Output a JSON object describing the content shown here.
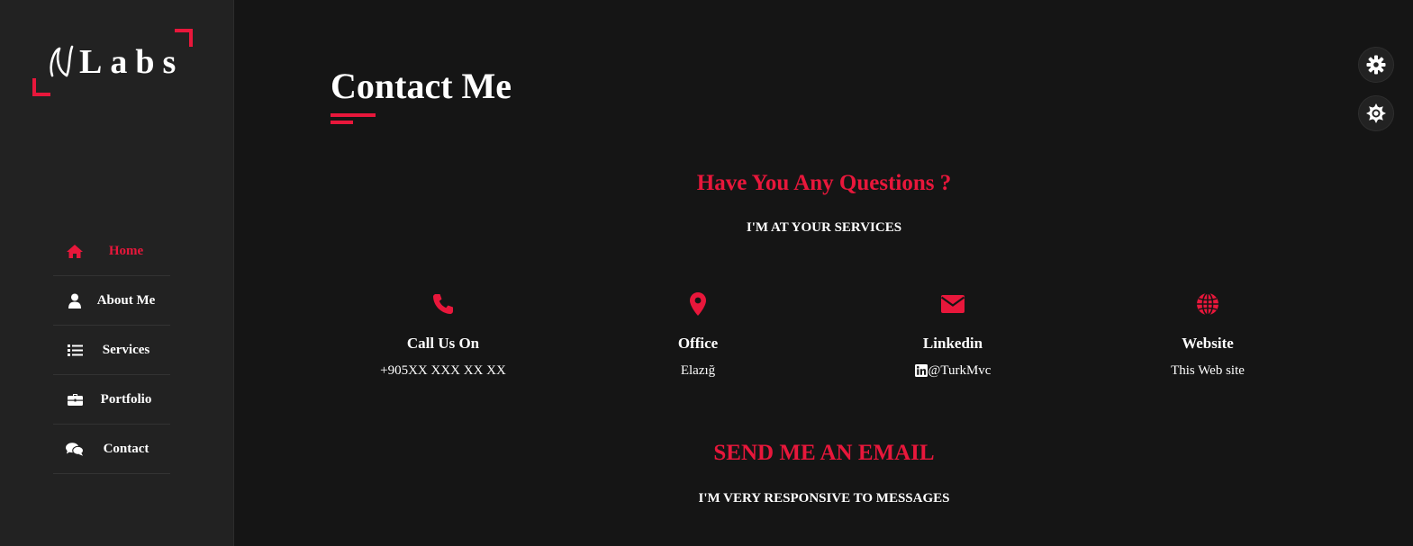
{
  "logo": {
    "text": "Labs"
  },
  "nav": {
    "items": [
      {
        "label": "Home",
        "icon": "home-icon",
        "active": true
      },
      {
        "label": "About Me",
        "icon": "user-icon"
      },
      {
        "label": "Services",
        "icon": "list-icon"
      },
      {
        "label": "Portfolio",
        "icon": "briefcase-icon"
      },
      {
        "label": "Contact",
        "icon": "comments-icon"
      }
    ]
  },
  "main": {
    "title": "Contact Me",
    "questions_heading": "Have You Any Questions ?",
    "questions_sub": "I'M AT YOUR SERVICES",
    "cards": [
      {
        "title": "Call Us On",
        "value": "+905XX XXX XX XX",
        "icon": "phone-icon"
      },
      {
        "title": "Office",
        "value": "Elazığ",
        "icon": "map-marker-icon"
      },
      {
        "title": "Linkedin",
        "value": "@TurkMvc",
        "icon": "envelope-icon"
      },
      {
        "title": "Website",
        "value": "This Web site",
        "icon": "globe-icon"
      }
    ],
    "email_heading": "SEND ME AN EMAIL",
    "email_sub": "I'M VERY RESPONSIVE TO MESSAGES"
  },
  "floating_buttons": [
    {
      "icon": "gear-icon"
    },
    {
      "icon": "sun-gear-icon"
    }
  ],
  "colors": {
    "accent": "#e8173b",
    "background": "#151515",
    "sidebar": "#222222"
  }
}
